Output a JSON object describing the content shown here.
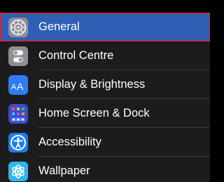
{
  "settings": {
    "items": [
      {
        "label": "General",
        "icon": "gear-icon",
        "icon_bg": "#8e8e93",
        "selected": true
      },
      {
        "label": "Control Centre",
        "icon": "toggles-icon",
        "icon_bg": "#8e8e93",
        "selected": false
      },
      {
        "label": "Display & Brightness",
        "icon": "text-size-icon",
        "icon_bg": "#2f7cf6",
        "selected": false
      },
      {
        "label": "Home Screen & Dock",
        "icon": "app-grid-icon",
        "icon_bg": "#3a4bd8",
        "selected": false
      },
      {
        "label": "Accessibility",
        "icon": "accessibility-icon",
        "icon_bg": "#1e7cf2",
        "selected": false
      },
      {
        "label": "Wallpaper",
        "icon": "flower-icon",
        "icon_bg": "#2fb6ea",
        "selected": false
      }
    ],
    "display_icon_glyph": "AA",
    "highlight_color": "#2f5fb4",
    "highlight_border_color": "#b0324c"
  }
}
